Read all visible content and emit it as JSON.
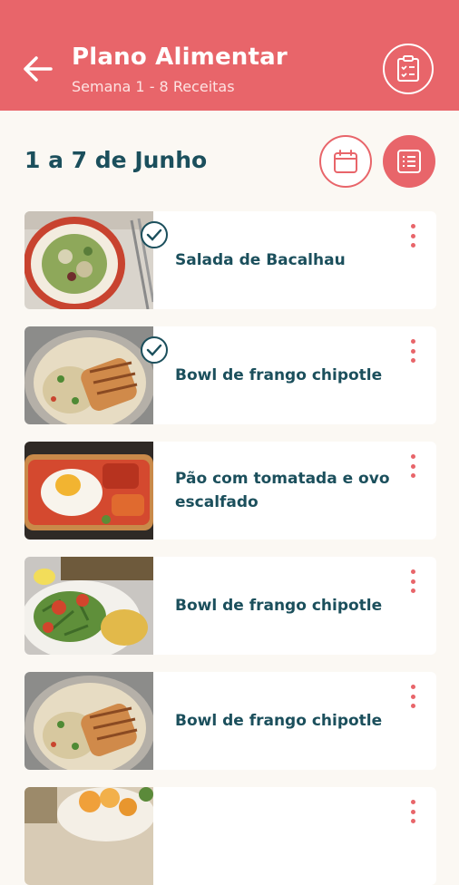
{
  "header": {
    "title": "Plano Alimentar",
    "subtitle": "Semana 1 - 8 Receitas",
    "background": "#e8656a"
  },
  "week": {
    "label": "1 a 7 de Junho"
  },
  "icons": {
    "back": "arrow-left-icon",
    "shopping_list": "clipboard-checklist-icon",
    "calendar": "calendar-icon",
    "list_view": "list-icon",
    "done": "checkmark-circle-icon",
    "menu": "more-vertical-icon"
  },
  "recipes": [
    {
      "name": "Salada de Bacalhau",
      "done": true,
      "image": "salad-cod"
    },
    {
      "name": "Bowl de frango chipotle",
      "done": true,
      "image": "chicken-bowl"
    },
    {
      "name": "Pão com tomatada e ovo escalfado",
      "done": false,
      "image": "bread-egg"
    },
    {
      "name": "Bowl de frango chipotle",
      "done": false,
      "image": "salad-tomato"
    },
    {
      "name": "Bowl de frango chipotle",
      "done": false,
      "image": "chicken-bowl"
    },
    {
      "name": "",
      "done": false,
      "image": "fruit-plate"
    }
  ],
  "colors": {
    "accent": "#e8656a",
    "text": "#1b4f5c",
    "background": "#fbf8f3"
  }
}
